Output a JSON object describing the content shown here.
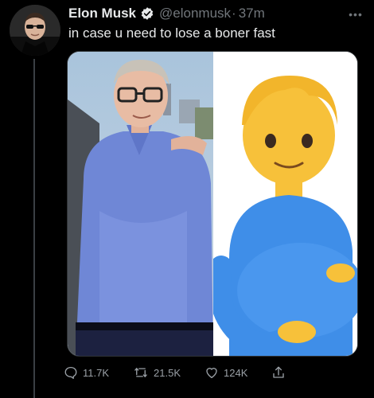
{
  "tweet": {
    "author_name": "Elon Musk",
    "handle": "@elonmusk",
    "separator": "·",
    "time": "37m",
    "text": "in case u need to lose a boner fast",
    "more_label": "•••"
  },
  "actions": {
    "replies": "11.7K",
    "retweets": "21.5K",
    "likes": "124K"
  },
  "colors": {
    "background": "#000000",
    "text": "#e7e9ea",
    "secondary": "#71767b",
    "verified": "#e7e9ea"
  },
  "icons": {
    "verified": "verified-badge-icon",
    "more": "more-options-icon",
    "reply": "reply-icon",
    "retweet": "retweet-icon",
    "like": "heart-icon",
    "share": "share-icon"
  }
}
